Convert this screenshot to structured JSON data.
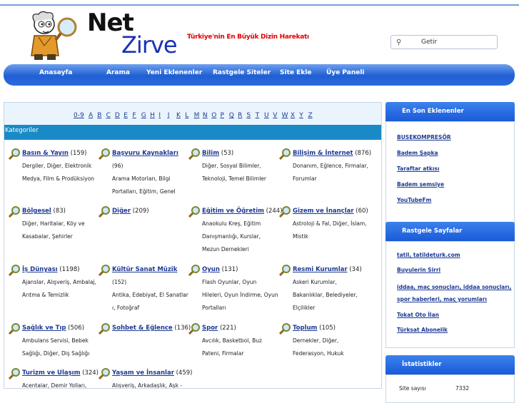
{
  "brand": {
    "word1": "Net",
    "word2": "Zirve",
    "tagline": "Türkiye'nin En Büyük Dizin Harekatı"
  },
  "search": {
    "button": "Getir"
  },
  "nav": {
    "items": [
      "Anasayfa",
      "Arama",
      "Yeni Eklenenler",
      "Rastgele Siteler",
      "Site Ekle",
      "Üye Paneli"
    ]
  },
  "alphabet": [
    "0-9",
    "A",
    "B",
    "C",
    "D",
    "E",
    "F",
    "G",
    "H",
    "I",
    "J",
    "K",
    "L",
    "M",
    "N",
    "O",
    "P",
    "Q",
    "R",
    "S",
    "T",
    "U",
    "V",
    "W",
    "X",
    "Y",
    "Z"
  ],
  "categories_title": "Kategoriler",
  "categories": [
    {
      "name": "Basın & Yayın",
      "count": "(159)",
      "subs": [
        "Dergiler, Diğer, Elektronik",
        "Medya, Film & Prodüksiyon"
      ]
    },
    {
      "name": "Başvuru Kaynakları",
      "count": "",
      "subs": [
        "(96)",
        "Arama Motorları, Bilgi",
        "Portalları, Eğitim, Genel"
      ]
    },
    {
      "name": "Bilim",
      "count": "(53)",
      "subs": [
        "Diğer, Sosyal Bilimler,",
        "Teknoloji, Temel Bilimler"
      ]
    },
    {
      "name": "Bilişim & İnternet",
      "count": "(876)",
      "subs": [
        "Donanım, Eğlence, Firmalar,",
        "Forumlar"
      ]
    },
    {
      "name": "Bölgesel",
      "count": "(83)",
      "subs": [
        "Diğer, Haritalar, Köy ve",
        "Kasabalar, Şehirler"
      ]
    },
    {
      "name": "Diğer",
      "count": "(209)",
      "subs": []
    },
    {
      "name": "Eğitim ve Öğretim",
      "count": "(244)",
      "subs": [
        "Anaokulu Kreş, Eğitim",
        "Danışmanlığı, Kurslar,",
        "Mezun Dernekleri"
      ]
    },
    {
      "name": "Gizem ve İnançlar",
      "count": "(60)",
      "subs": [
        "Astroloji & Fal, Diğer, İslam,",
        "Mistik"
      ]
    },
    {
      "name": "İş Dünyası",
      "count": "(1198)",
      "subs": [
        "Ajanslar, Alışveriş, Ambalaj,",
        "Arıtma & Temizlik"
      ]
    },
    {
      "name": "Kültür Sanat Müzik",
      "count": "",
      "subs": [
        "(152)",
        "Antika, Edebiyat, El Sanatlar",
        "ı, Fotoğraf"
      ]
    },
    {
      "name": "Oyun",
      "count": "(131)",
      "subs": [
        "Flash Oyunlar, Oyun",
        "Hileleri, Oyun İndirme, Oyun",
        "Portalları"
      ]
    },
    {
      "name": "Resmi Kurumlar",
      "count": "(34)",
      "subs": [
        "Askeri Kurumlar,",
        "Bakanlıklar, Belediyeler,",
        "Elçilikler"
      ]
    },
    {
      "name": "Sağlık ve Tıp",
      "count": "(506)",
      "subs": [
        "Ambulans Servisi, Bebek",
        "Sağlığı, Diğer, Diş Sağlığı"
      ]
    },
    {
      "name": "Sohbet & Eğlence",
      "count": "(136)",
      "subs": []
    },
    {
      "name": "Spor",
      "count": "(221)",
      "subs": [
        "Avcılık, Basketbol, Buz",
        "Pateni, Firmalar"
      ]
    },
    {
      "name": "Toplum",
      "count": "(105)",
      "subs": [
        "Dernekler, Diğer,",
        "Federasyon, Hukuk"
      ]
    },
    {
      "name": "Turizm ve Ulaşım",
      "count": "(324)",
      "subs": [
        "Acentalar, Demir Yolları,"
      ]
    },
    {
      "name": "Yaşam ve İnsanlar",
      "count": "(459)",
      "subs": [
        "Alışveriş, Arkadaşlık, Aşk -"
      ]
    }
  ],
  "sidebar": {
    "latest_title": "En Son Eklenenler",
    "latest": [
      "BUSEKOMPRESÖR",
      "Badem Şapka",
      "Taraftar atkısı",
      "Badem şemsiye",
      "YouTubeFm"
    ],
    "random_title": "Rastgele Sayfalar",
    "random": [
      "tatil, tatildeturk.com",
      "Buyulerin Sirri",
      "iddaa, maç sonuçları, iddaa sonuçları,",
      "spor haberleri, maç yorumları",
      "Tokat Oto İlan",
      "Türksat Abonelik"
    ],
    "stats_title": "İstatistikler",
    "stats_label": "Site sayısı",
    "stats_value": "7332"
  }
}
